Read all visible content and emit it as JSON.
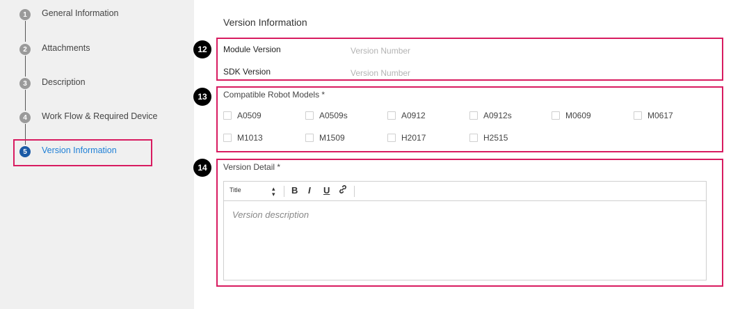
{
  "sidebar": {
    "steps": [
      {
        "number": "1",
        "label": "General Information"
      },
      {
        "number": "2",
        "label": "Attachments"
      },
      {
        "number": "3",
        "label": "Description"
      },
      {
        "number": "4",
        "label": "Work Flow & Required Device"
      },
      {
        "number": "5",
        "label": "Version Information"
      }
    ],
    "active_step": 5
  },
  "main": {
    "title": "Version Information",
    "callouts": [
      "12",
      "13",
      "14"
    ],
    "module_version": {
      "label": "Module Version",
      "placeholder": "Version Number",
      "value": ""
    },
    "sdk_version": {
      "label": "SDK Version",
      "placeholder": "Version Number",
      "value": ""
    },
    "compatible_models": {
      "label": "Compatible Robot Models *",
      "options": [
        "A0509",
        "A0509s",
        "A0912",
        "A0912s",
        "M0609",
        "M0617",
        "M1013",
        "M1509",
        "H2017",
        "H2515"
      ]
    },
    "version_detail": {
      "label": "Version Detail *",
      "toolbar": {
        "heading_select": "Title",
        "bold": "B",
        "italic": "I",
        "underline": "U"
      },
      "placeholder": "Version description"
    }
  },
  "colors": {
    "accent": "#d81b60",
    "active_step": "#1a5aa6",
    "active_text": "#1e7fd6",
    "sidebar_bg": "#f0f0f0"
  }
}
